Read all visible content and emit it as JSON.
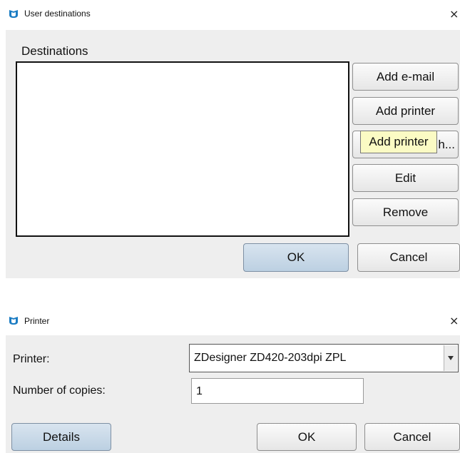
{
  "dialog1": {
    "title": "User destinations",
    "close_label": "×",
    "section_label": "Destinations",
    "buttons": {
      "add_email": "Add e-mail",
      "add_printer": "Add printer",
      "hidden_button_fragment": "h...",
      "edit": "Edit",
      "remove": "Remove",
      "ok": "OK",
      "cancel": "Cancel"
    },
    "tooltip": "Add printer"
  },
  "dialog2": {
    "title": "Printer",
    "close_label": "×",
    "printer_label": "Printer:",
    "printer_value": "ZDesigner ZD420-203dpi ZPL",
    "copies_label": "Number of copies:",
    "copies_value": "1",
    "buttons": {
      "details": "Details",
      "ok": "OK",
      "cancel": "Cancel"
    }
  },
  "colors": {
    "panel_bg": "#eeeeee",
    "app_icon": "#1b7cc3",
    "tooltip_bg": "#fbfbc4",
    "default_button": "#c8d8e7"
  },
  "icons": [
    "app-logo-icon",
    "close-icon",
    "dropdown-arrow-icon"
  ]
}
